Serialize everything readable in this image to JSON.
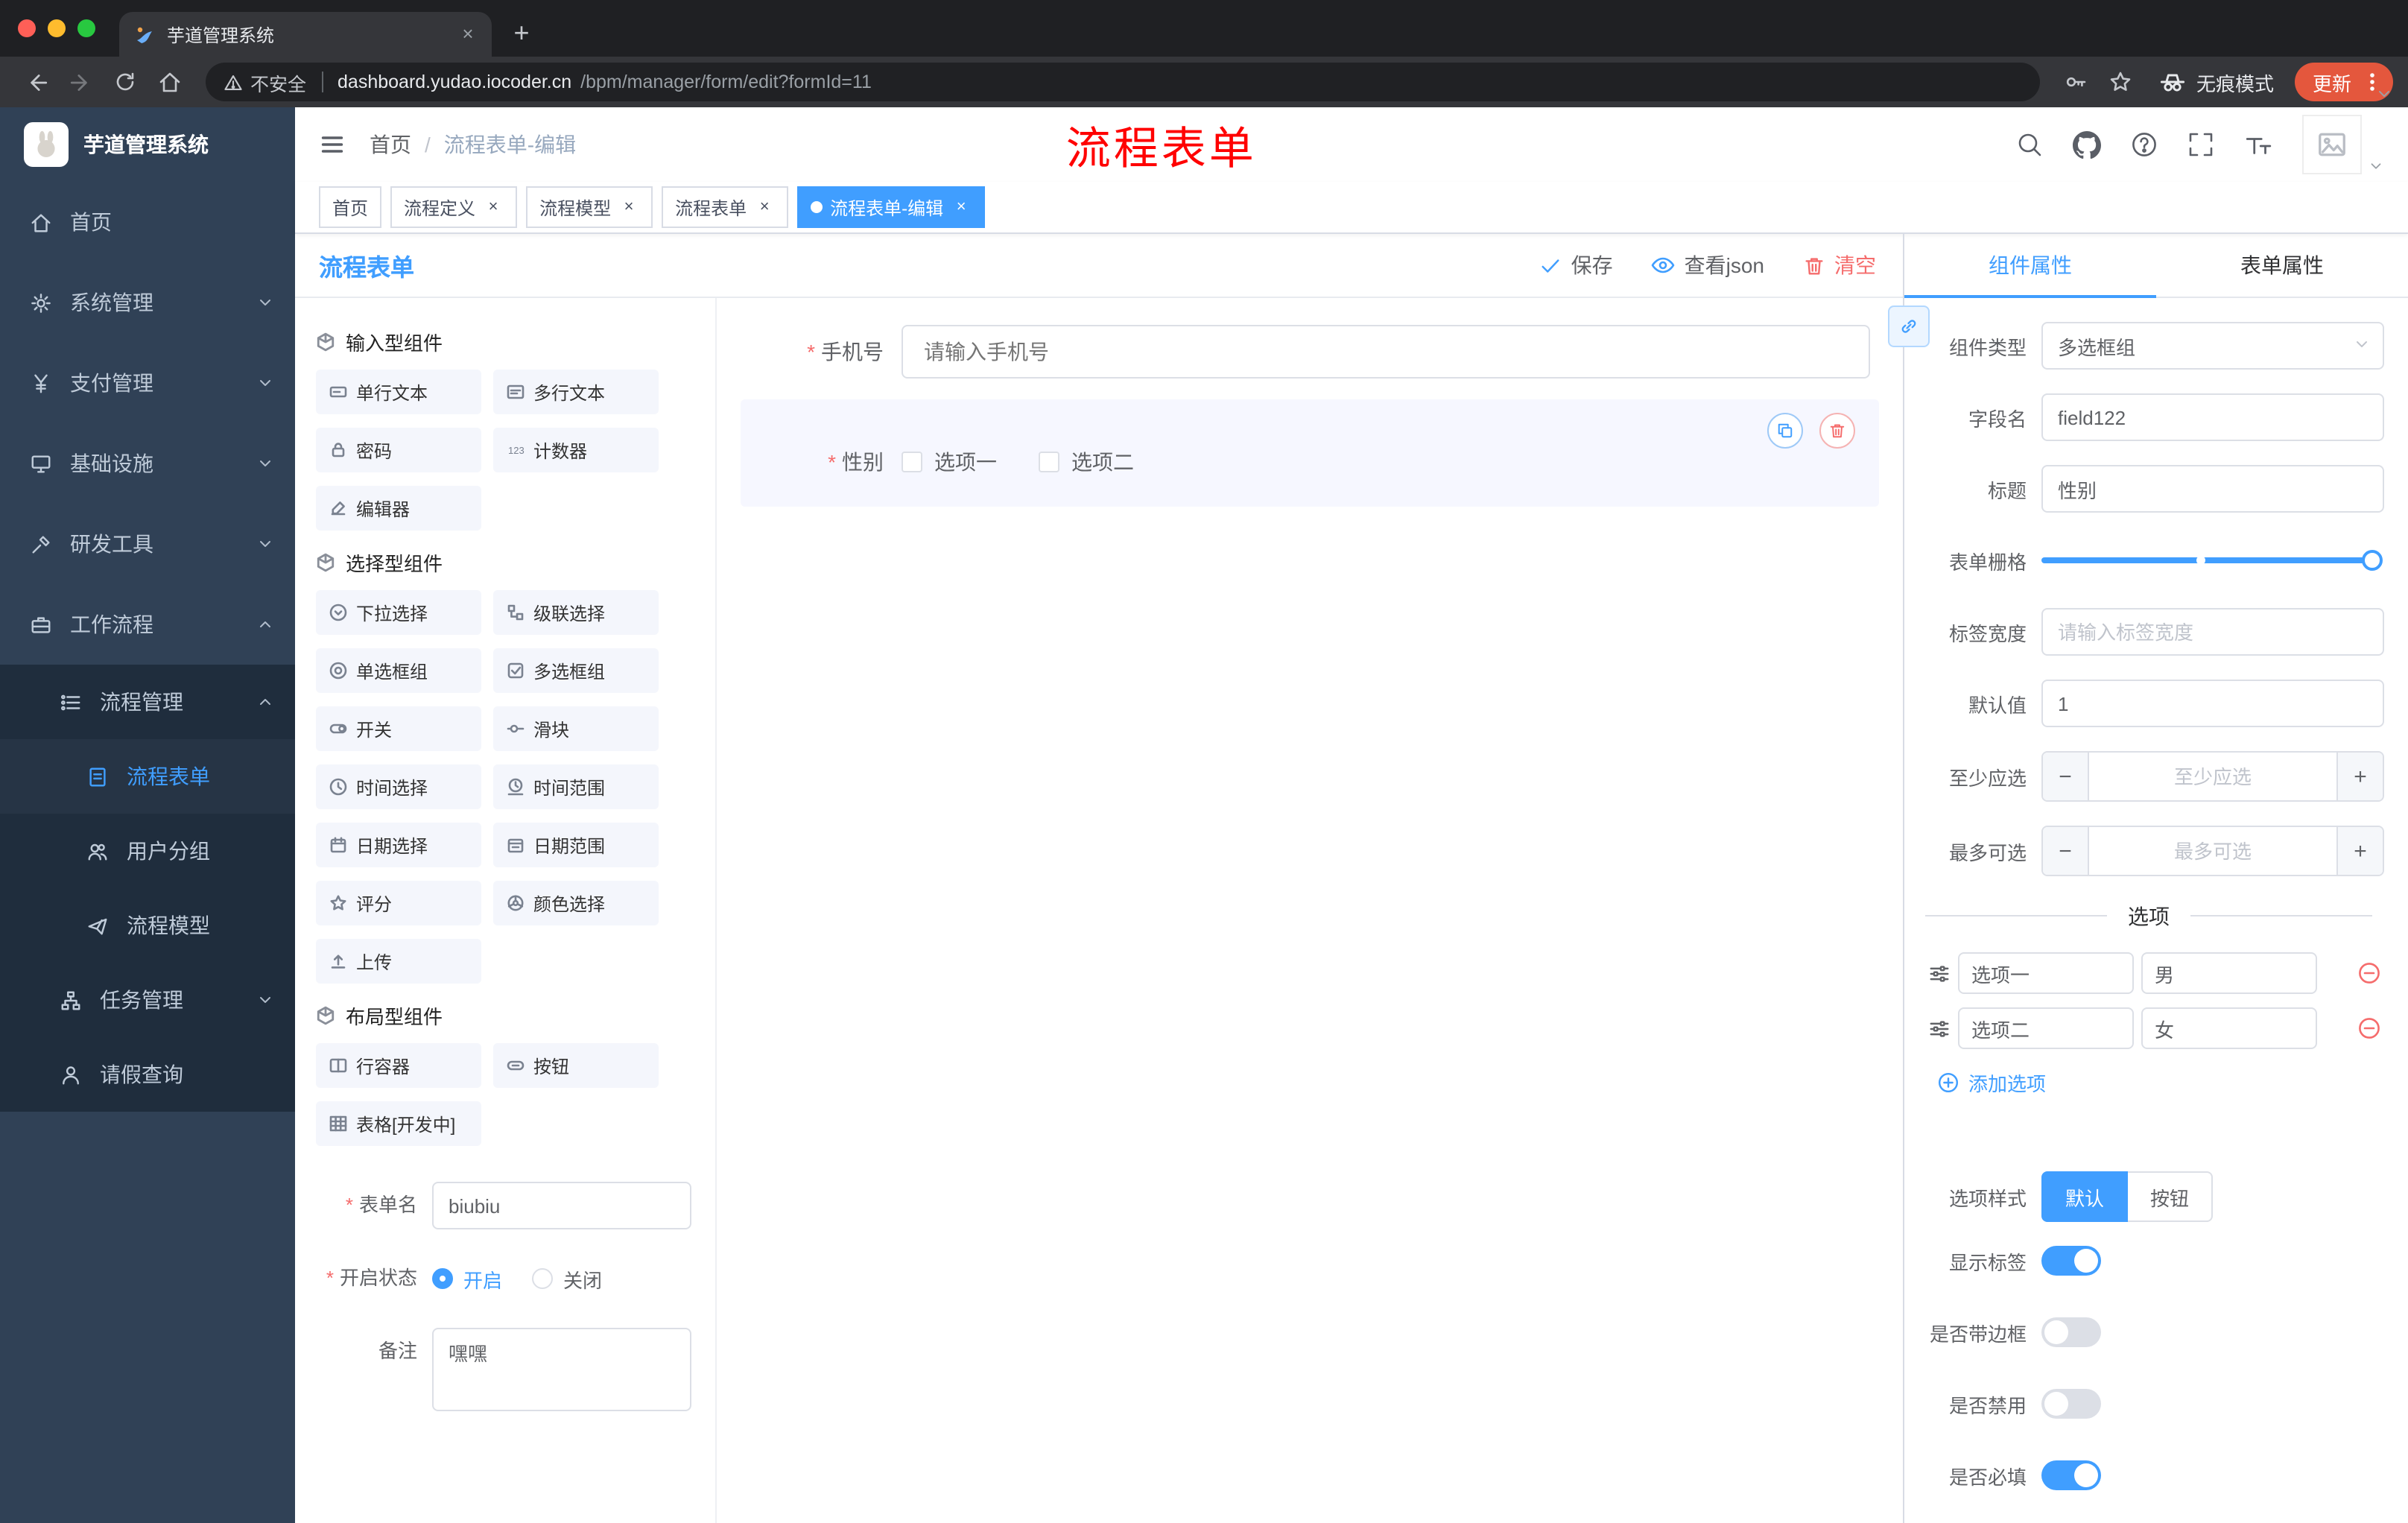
{
  "colors": {
    "accent": "#409eff",
    "danger": "#f56c6c",
    "annotation_red": "#ff0000",
    "sidebar_bg": "#304156",
    "submenu_bg": "#1f2d3d",
    "update_button": "#e4573d"
  },
  "icons": {
    "save": "check",
    "view_json": "eye",
    "clear": "trash",
    "copy": "copy-squares",
    "delete": "trash",
    "search": "magnifier",
    "github": "octocat",
    "help": "question-circle",
    "fullscreen": "corner-brackets",
    "font_size": "Tt",
    "incognito": "spy-glasses",
    "menu": "kebab-dots",
    "option_drag": "sliders",
    "remove_option": "minus-circle",
    "add_option": "plus-circle"
  },
  "browser": {
    "tab_title": "芋道管理系统",
    "security_label": "不安全",
    "url_host": "dashboard.yudao.iocoder.cn",
    "url_path": "/bpm/manager/form/edit?formId=11",
    "incognito_label": "无痕模式",
    "update_label": "更新"
  },
  "sidebar": {
    "app_title": "芋道管理系统",
    "items": [
      {
        "label": "首页"
      },
      {
        "label": "系统管理"
      },
      {
        "label": "支付管理"
      },
      {
        "label": "基础设施"
      },
      {
        "label": "研发工具"
      },
      {
        "label": "工作流程"
      },
      {
        "label": "流程管理"
      },
      {
        "label": "流程表单"
      },
      {
        "label": "用户分组"
      },
      {
        "label": "流程模型"
      },
      {
        "label": "任务管理"
      },
      {
        "label": "请假查询"
      }
    ]
  },
  "navbar": {
    "breadcrumb": {
      "home": "首页",
      "current": "流程表单-编辑"
    },
    "annotation": "流程表单"
  },
  "tags": [
    {
      "label": "首页"
    },
    {
      "label": "流程定义"
    },
    {
      "label": "流程模型"
    },
    {
      "label": "流程表单"
    },
    {
      "label": "流程表单-编辑"
    }
  ],
  "designer": {
    "panel_title": "流程表单",
    "actions": {
      "save": "保存",
      "view_json": "查看json",
      "clear": "清空"
    },
    "groups": [
      {
        "title": "输入型组件"
      },
      {
        "title": "选择型组件"
      },
      {
        "title": "布局型组件"
      }
    ],
    "components": {
      "input": [
        "单行文本",
        "多行文本",
        "密码",
        "计数器",
        "编辑器"
      ],
      "select": [
        "下拉选择",
        "级联选择",
        "单选框组",
        "多选框组",
        "开关",
        "滑块",
        "时间选择",
        "时间范围",
        "日期选择",
        "日期范围",
        "评分",
        "颜色选择",
        "上传"
      ],
      "layout": [
        "行容器",
        "按钮",
        "表格[开发中]"
      ]
    },
    "meta": {
      "form_name_label": "表单名",
      "form_name_value": "biubiu",
      "status_label": "开启状态",
      "status_on": "开启",
      "status_off": "关闭",
      "status_selected": "开启",
      "remark_label": "备注",
      "remark_value": "嘿嘿"
    }
  },
  "canvas": {
    "phone": {
      "label": "手机号",
      "placeholder": "请输入手机号"
    },
    "gender": {
      "label": "性别",
      "option1": "选项一",
      "option2": "选项二"
    }
  },
  "props": {
    "tab_component": "组件属性",
    "tab_form": "表单属性",
    "component_type": {
      "label": "组件类型",
      "value": "多选框组"
    },
    "field_name": {
      "label": "字段名",
      "value": "field122"
    },
    "title": {
      "label": "标题",
      "value": "性别"
    },
    "grid": {
      "label": "表单栅格"
    },
    "label_width": {
      "label": "标签宽度",
      "placeholder": "请输入标签宽度"
    },
    "default_value": {
      "label": "默认值",
      "value": "1"
    },
    "min_select": {
      "label": "至少应选",
      "placeholder": "至少应选"
    },
    "max_select": {
      "label": "最多可选",
      "placeholder": "最多可选"
    },
    "options_title": "选项",
    "options": [
      {
        "name": "选项一",
        "value": "男"
      },
      {
        "name": "选项二",
        "value": "女"
      }
    ],
    "add_option": "添加选项",
    "option_style": {
      "label": "选项样式",
      "default": "默认",
      "button": "按钮",
      "selected": "默认"
    },
    "toggles": [
      {
        "label": "显示标签",
        "on": true
      },
      {
        "label": "是否带边框",
        "on": false
      },
      {
        "label": "是否禁用",
        "on": false
      },
      {
        "label": "是否必填",
        "on": true
      }
    ]
  }
}
